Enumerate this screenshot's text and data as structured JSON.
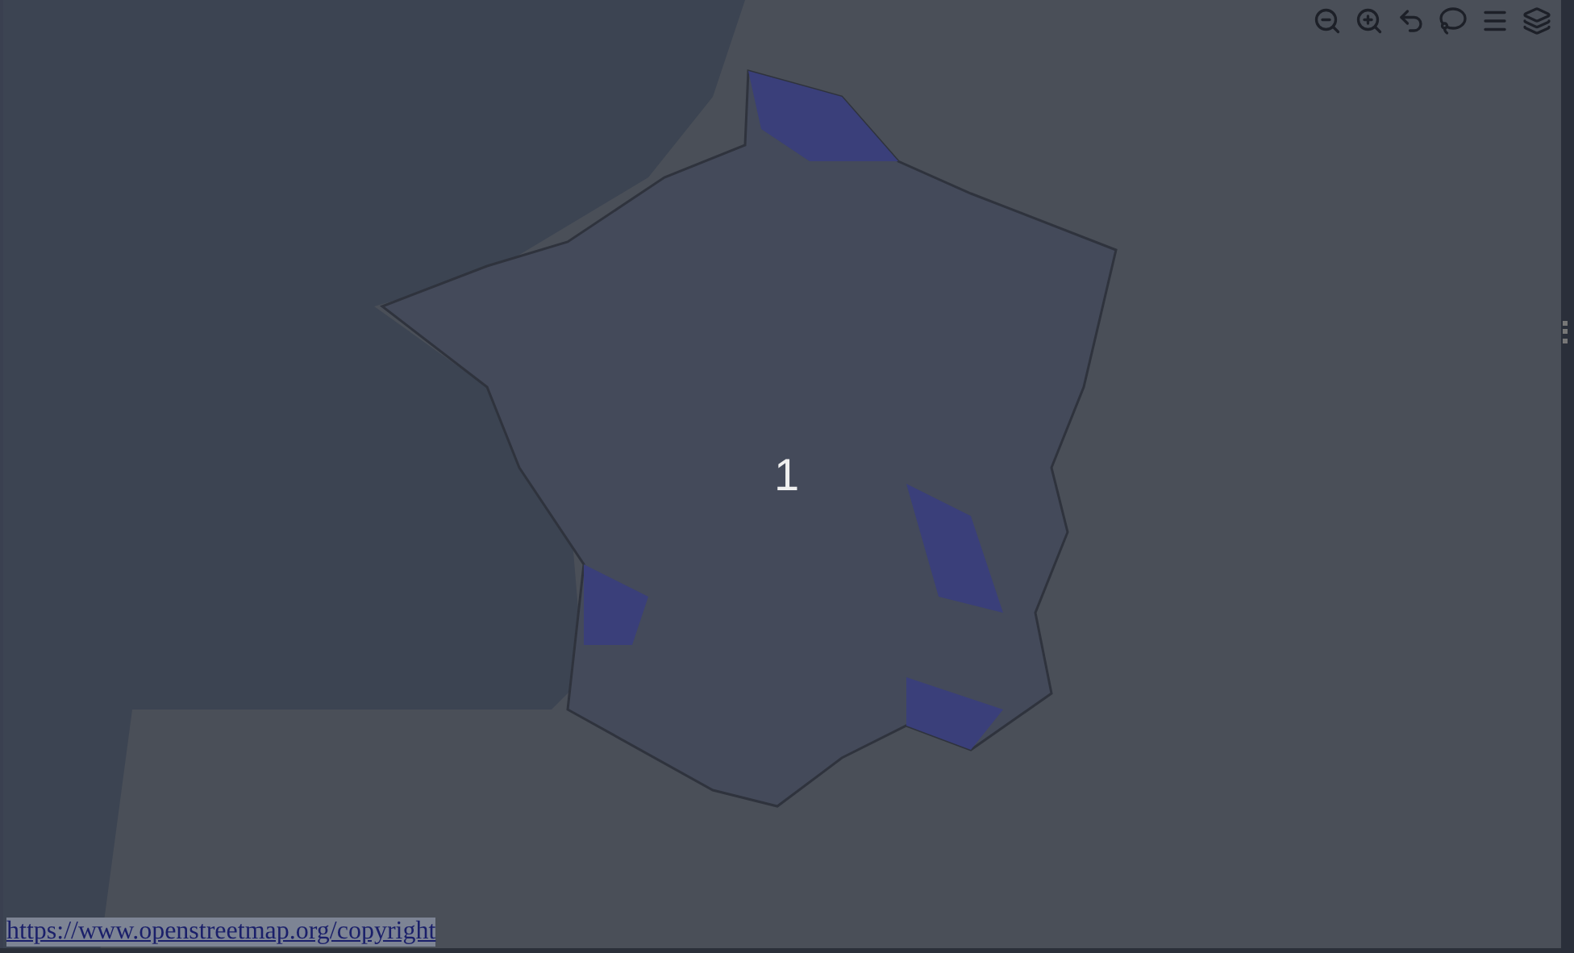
{
  "map": {
    "cluster_label": "1"
  },
  "attribution": {
    "link": "https://www.openstreetmap.org/copyright"
  }
}
